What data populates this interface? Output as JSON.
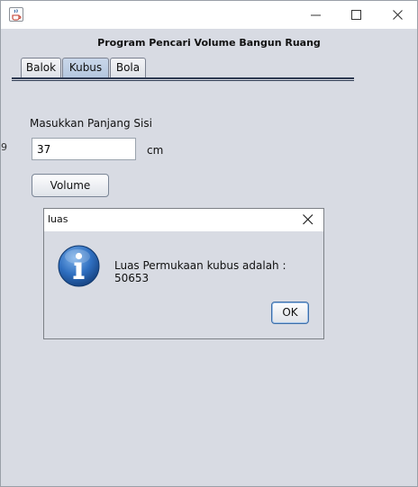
{
  "window": {
    "title": "",
    "icon": "java-cup-icon",
    "controls": [
      "minimize-icon",
      "maximize-icon",
      "close-icon"
    ]
  },
  "heading": "Program Pencari Volume Bangun Ruang",
  "tabs": [
    {
      "label": "Balok",
      "selected": false
    },
    {
      "label": "Kubus",
      "selected": true
    },
    {
      "label": "Bola",
      "selected": false
    }
  ],
  "form": {
    "side_label": "Masukkan Panjang Sisi",
    "side_value": "37",
    "unit_label": "cm",
    "volume_button": "Volume"
  },
  "dialog": {
    "title": "luas",
    "icon": "info-icon",
    "message": "Luas Permukaan kubus adalah : 50653",
    "ok_button": "OK"
  },
  "edge_glyph": "9",
  "colors": {
    "window_bg": "#d8dbe3",
    "tab_selected": "#b4c6de",
    "info_icon": "#1f5ea8",
    "ok_focus": "#3c6ea8"
  }
}
